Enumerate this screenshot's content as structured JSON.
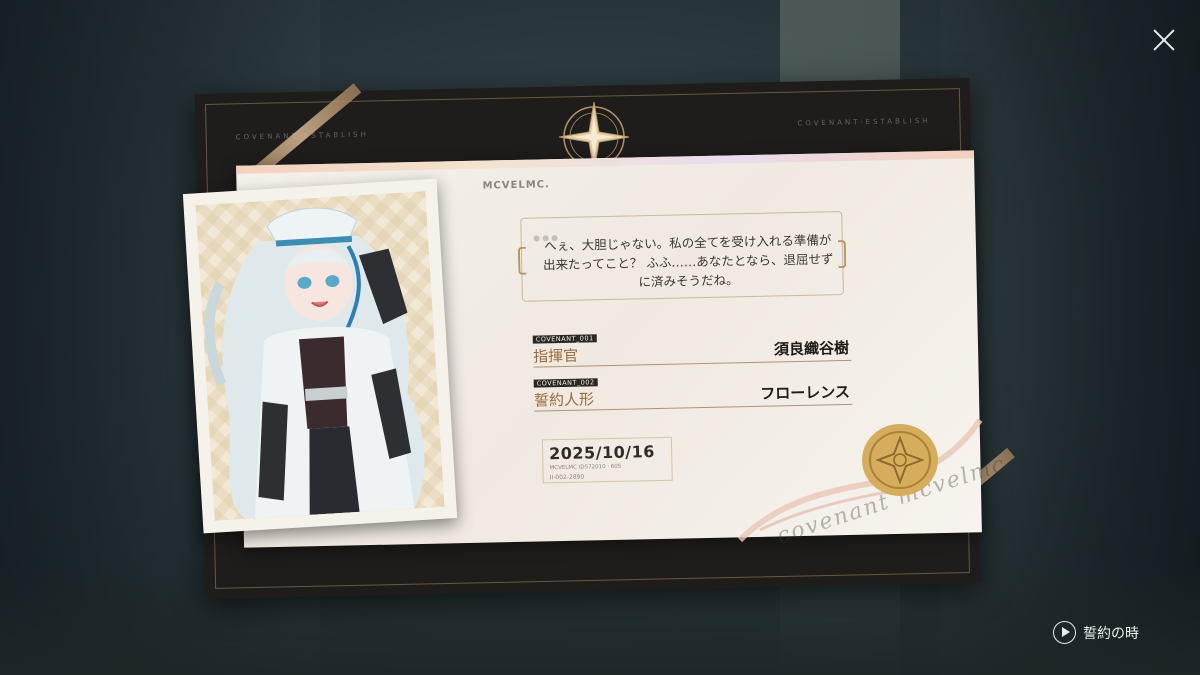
{
  "board": {
    "label_left": "COVENANT ESTABLISH",
    "label_right": "COVENANT·ESTABLISH"
  },
  "card": {
    "brand": "MCVELMC.",
    "quote": "へぇ、大胆じゃない。私の全てを受け入れる準備が出来たってこと？ ふふ……あなたとなら、退屈せずに済みそうだね。",
    "fields": [
      {
        "tag": "COVENANT_001",
        "label": "指揮官",
        "value": "須良織谷樹"
      },
      {
        "tag": "COVENANT_002",
        "label": "誓約人形",
        "value": "フローレンス"
      }
    ],
    "date": "2025/10/16",
    "date_meta1": "MCVELMC  ID572010 · 605",
    "date_meta2": "II-002-2890",
    "cursive": "covenant mcvelmc"
  },
  "controls": {
    "play_label": "誓約の時",
    "close_icon": "close-icon",
    "play_icon": "play-icon"
  },
  "colors": {
    "accent_gold": "#b4946a",
    "label_brown": "#9a6a3c",
    "seal_gold": "#d6ad5c"
  }
}
